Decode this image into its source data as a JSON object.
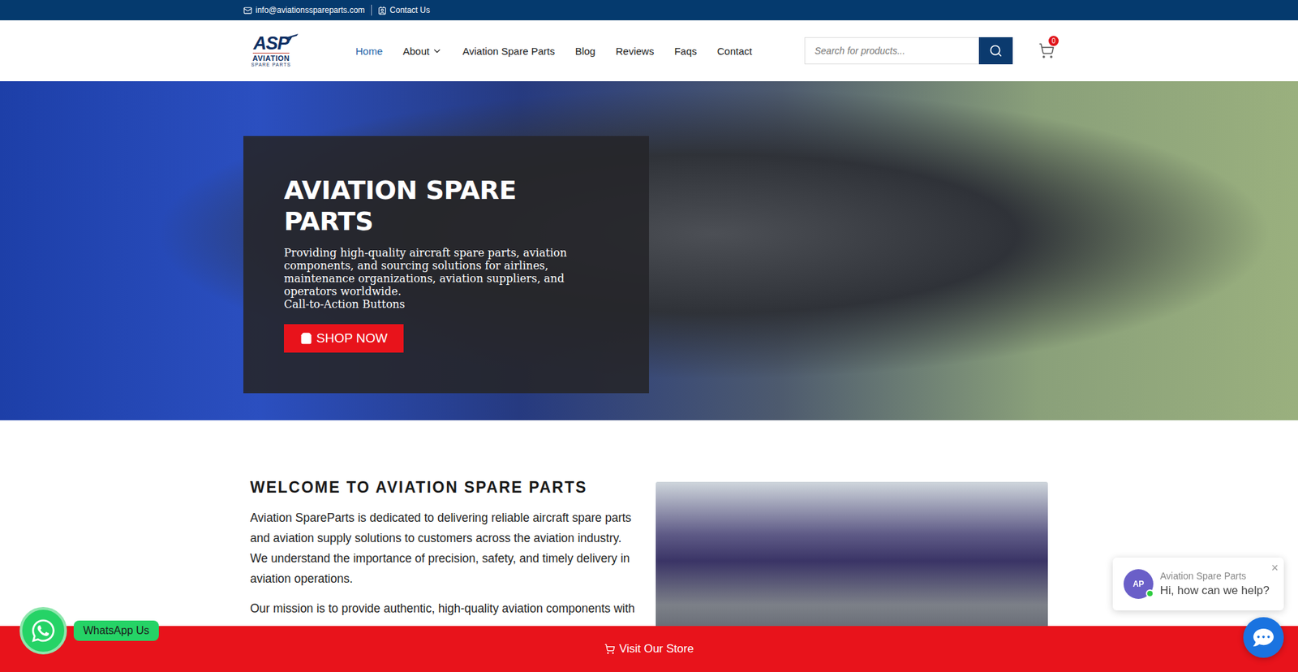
{
  "topbar": {
    "email": "info@aviationsspareparts.com",
    "contact": "Contact Us"
  },
  "logo": {
    "mark": "ASP",
    "name": "AVIATION",
    "tagline": "SPARE PARTS"
  },
  "nav": [
    {
      "label": "Home",
      "selected": true,
      "dropdown": false
    },
    {
      "label": "About",
      "selected": false,
      "dropdown": true
    },
    {
      "label": "Aviation Spare Parts",
      "selected": false,
      "dropdown": false
    },
    {
      "label": "Blog",
      "selected": false,
      "dropdown": false
    },
    {
      "label": "Reviews",
      "selected": false,
      "dropdown": false
    },
    {
      "label": "Faqs",
      "selected": false,
      "dropdown": false
    },
    {
      "label": "Contact",
      "selected": false,
      "dropdown": false
    }
  ],
  "search": {
    "placeholder": "Search for products..."
  },
  "cart": {
    "count": "0"
  },
  "hero": {
    "title": "AVIATION SPARE PARTS",
    "subtitle": "Providing high-quality aircraft spare parts, aviation components, and sourcing solutions for airlines, maintenance organizations, aviation suppliers, and operators worldwide.",
    "note": "Call-to-Action Buttons",
    "button": "SHOP NOW"
  },
  "welcome": {
    "title": "WELCOME TO AVIATION SPARE PARTS",
    "paragraphs": [
      "Aviation SpareParts is dedicated to delivering reliable aircraft spare parts and aviation supply solutions to customers across the aviation industry. We understand the importance of precision, safety, and timely delivery in aviation operations.",
      "Our mission is to provide authentic, high-quality aviation components with"
    ]
  },
  "whatsapp": {
    "label": "WhatsApp Us"
  },
  "chat": {
    "avatar": "AP",
    "name": "Aviation Spare Parts",
    "message": "Hi, how can we help?",
    "close": "×",
    "online": true
  },
  "store_bar": {
    "label": "Visit Our Store"
  }
}
